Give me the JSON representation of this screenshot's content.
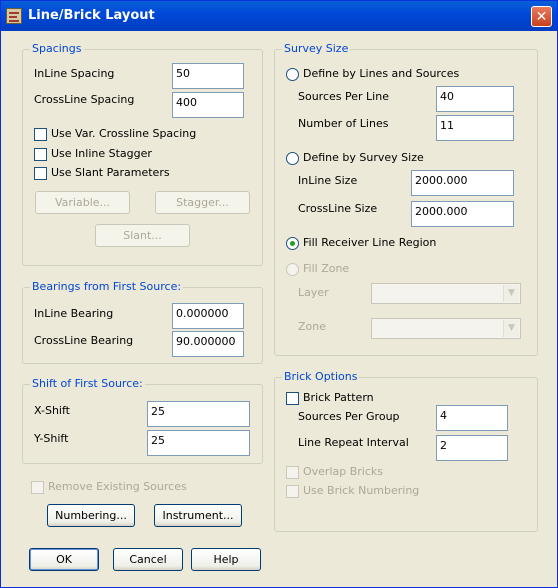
{
  "window": {
    "title": "Line/Brick Layout",
    "close_glyph": "✕"
  },
  "spacings": {
    "legend": "Spacings",
    "inline_label": "InLine Spacing",
    "inline_value": "50",
    "crossline_label": "CrossLine Spacing",
    "crossline_value": "400",
    "var_crossline_label": "Use Var. Crossline Spacing",
    "inline_stagger_label": "Use Inline Stagger",
    "slant_params_label": "Use Slant Parameters",
    "variable_button": "Variable...",
    "stagger_button": "Stagger...",
    "slant_button": "Slant..."
  },
  "bearings": {
    "legend": "Bearings from First Source:",
    "inline_label": "InLine Bearing",
    "inline_value": "0.000000",
    "crossline_label": "CrossLine Bearing",
    "crossline_value": "90.000000"
  },
  "shift": {
    "legend": "Shift of First Source:",
    "x_label": "X-Shift",
    "x_value": "25",
    "y_label": "Y-Shift",
    "y_value": "25"
  },
  "remove_existing_label": "Remove Existing Sources",
  "numbering_button": "Numbering...",
  "instrument_button": "Instrument...",
  "survey": {
    "legend": "Survey Size",
    "define_lines_label": "Define by Lines and Sources",
    "sources_per_line_label": "Sources Per Line",
    "sources_per_line_value": "40",
    "number_of_lines_label": "Number of Lines",
    "number_of_lines_value": "11",
    "define_size_label": "Define by Survey Size",
    "inline_size_label": "InLine Size",
    "inline_size_value": "2000.000",
    "crossline_size_label": "CrossLine Size",
    "crossline_size_value": "2000.000",
    "fill_receiver_label": "Fill Receiver Line Region",
    "fill_zone_label": "Fill Zone",
    "layer_label": "Layer",
    "layer_value": "",
    "zone_label": "Zone",
    "zone_value": "",
    "selected_option": "fill_receiver"
  },
  "brick": {
    "legend": "Brick Options",
    "pattern_label": "Brick Pattern",
    "sources_per_group_label": "Sources Per Group",
    "sources_per_group_value": "4",
    "line_repeat_label": "Line Repeat Interval",
    "line_repeat_value": "2",
    "overlap_label": "Overlap Bricks",
    "numbering_label": "Use Brick Numbering"
  },
  "footer": {
    "ok": "OK",
    "cancel": "Cancel",
    "help": "Help"
  },
  "colors": {
    "title_bar": "#0049d8",
    "group_legend": "#0046d5",
    "selected_radio": "#21a121",
    "dialog_bg": "#ece9d8"
  }
}
